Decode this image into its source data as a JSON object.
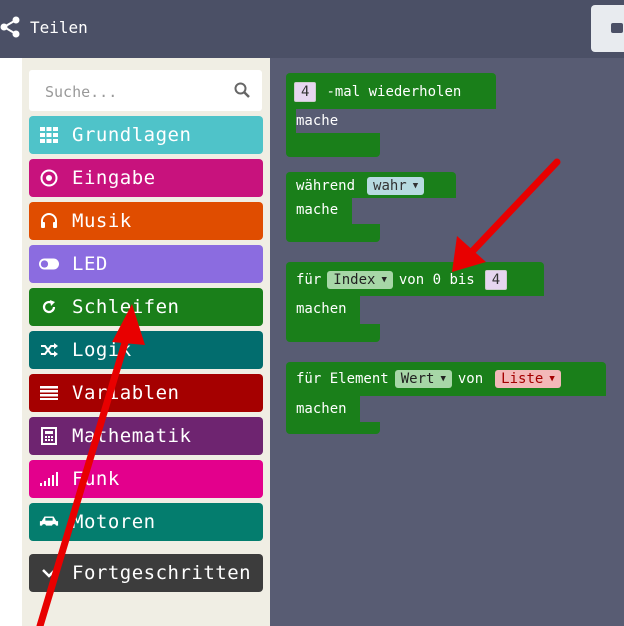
{
  "header": {
    "share_label": "Teilen"
  },
  "toolbox": {
    "search_placeholder": "Suche...",
    "categories": [
      {
        "label": "Grundlagen",
        "color": "#4fc3c9",
        "icon": "grid-icon"
      },
      {
        "label": "Eingabe",
        "color": "#c8127d",
        "icon": "target-icon"
      },
      {
        "label": "Musik",
        "color": "#e04d00",
        "icon": "headphones-icon"
      },
      {
        "label": "LED",
        "color": "#8b6ce0",
        "icon": "toggle-icon"
      },
      {
        "label": "Schleifen",
        "color": "#1a7f1a",
        "icon": "refresh-icon"
      },
      {
        "label": "Logik",
        "color": "#026d6e",
        "icon": "shuffle-icon"
      },
      {
        "label": "Variablen",
        "color": "#a50000",
        "icon": "list-icon"
      },
      {
        "label": "Mathematik",
        "color": "#6e2470",
        "icon": "calculator-icon"
      },
      {
        "label": "Funk",
        "color": "#e3008c",
        "icon": "signal-icon"
      },
      {
        "label": "Motoren",
        "color": "#047d6e",
        "icon": "car-icon"
      },
      {
        "label": "Fortgeschritten",
        "color": "#3c3c3c",
        "icon": "chevron-down-icon"
      }
    ]
  },
  "blocks": {
    "repeat": {
      "count": "4",
      "text": "-mal wiederholen",
      "do": "mache"
    },
    "while": {
      "text": "während",
      "value": "wahr",
      "do": "mache"
    },
    "for": {
      "text": "für",
      "var": "Index",
      "from_text": "von 0 bis",
      "to": "4",
      "do": "machen"
    },
    "foreach": {
      "text": "für Element",
      "var": "Wert",
      "of_text": "von",
      "list": "Liste",
      "do": "machen"
    }
  }
}
